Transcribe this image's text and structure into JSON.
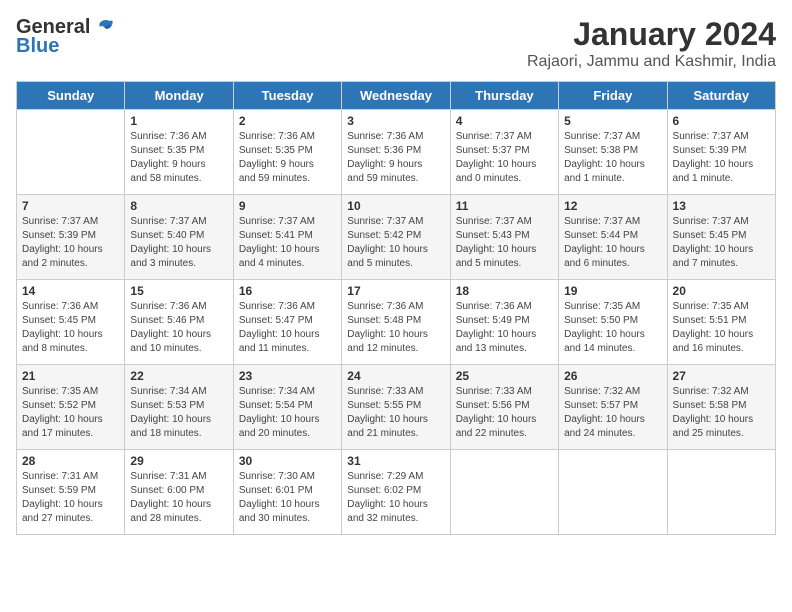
{
  "header": {
    "logo_general": "General",
    "logo_blue": "Blue",
    "month_title": "January 2024",
    "location": "Rajaori, Jammu and Kashmir, India"
  },
  "days_of_week": [
    "Sunday",
    "Monday",
    "Tuesday",
    "Wednesday",
    "Thursday",
    "Friday",
    "Saturday"
  ],
  "weeks": [
    [
      {
        "day": "",
        "info": ""
      },
      {
        "day": "1",
        "info": "Sunrise: 7:36 AM\nSunset: 5:35 PM\nDaylight: 9 hours\nand 58 minutes."
      },
      {
        "day": "2",
        "info": "Sunrise: 7:36 AM\nSunset: 5:35 PM\nDaylight: 9 hours\nand 59 minutes."
      },
      {
        "day": "3",
        "info": "Sunrise: 7:36 AM\nSunset: 5:36 PM\nDaylight: 9 hours\nand 59 minutes."
      },
      {
        "day": "4",
        "info": "Sunrise: 7:37 AM\nSunset: 5:37 PM\nDaylight: 10 hours\nand 0 minutes."
      },
      {
        "day": "5",
        "info": "Sunrise: 7:37 AM\nSunset: 5:38 PM\nDaylight: 10 hours\nand 1 minute."
      },
      {
        "day": "6",
        "info": "Sunrise: 7:37 AM\nSunset: 5:39 PM\nDaylight: 10 hours\nand 1 minute."
      }
    ],
    [
      {
        "day": "7",
        "info": "Sunrise: 7:37 AM\nSunset: 5:39 PM\nDaylight: 10 hours\nand 2 minutes."
      },
      {
        "day": "8",
        "info": "Sunrise: 7:37 AM\nSunset: 5:40 PM\nDaylight: 10 hours\nand 3 minutes."
      },
      {
        "day": "9",
        "info": "Sunrise: 7:37 AM\nSunset: 5:41 PM\nDaylight: 10 hours\nand 4 minutes."
      },
      {
        "day": "10",
        "info": "Sunrise: 7:37 AM\nSunset: 5:42 PM\nDaylight: 10 hours\nand 5 minutes."
      },
      {
        "day": "11",
        "info": "Sunrise: 7:37 AM\nSunset: 5:43 PM\nDaylight: 10 hours\nand 5 minutes."
      },
      {
        "day": "12",
        "info": "Sunrise: 7:37 AM\nSunset: 5:44 PM\nDaylight: 10 hours\nand 6 minutes."
      },
      {
        "day": "13",
        "info": "Sunrise: 7:37 AM\nSunset: 5:45 PM\nDaylight: 10 hours\nand 7 minutes."
      }
    ],
    [
      {
        "day": "14",
        "info": "Sunrise: 7:36 AM\nSunset: 5:45 PM\nDaylight: 10 hours\nand 8 minutes."
      },
      {
        "day": "15",
        "info": "Sunrise: 7:36 AM\nSunset: 5:46 PM\nDaylight: 10 hours\nand 10 minutes."
      },
      {
        "day": "16",
        "info": "Sunrise: 7:36 AM\nSunset: 5:47 PM\nDaylight: 10 hours\nand 11 minutes."
      },
      {
        "day": "17",
        "info": "Sunrise: 7:36 AM\nSunset: 5:48 PM\nDaylight: 10 hours\nand 12 minutes."
      },
      {
        "day": "18",
        "info": "Sunrise: 7:36 AM\nSunset: 5:49 PM\nDaylight: 10 hours\nand 13 minutes."
      },
      {
        "day": "19",
        "info": "Sunrise: 7:35 AM\nSunset: 5:50 PM\nDaylight: 10 hours\nand 14 minutes."
      },
      {
        "day": "20",
        "info": "Sunrise: 7:35 AM\nSunset: 5:51 PM\nDaylight: 10 hours\nand 16 minutes."
      }
    ],
    [
      {
        "day": "21",
        "info": "Sunrise: 7:35 AM\nSunset: 5:52 PM\nDaylight: 10 hours\nand 17 minutes."
      },
      {
        "day": "22",
        "info": "Sunrise: 7:34 AM\nSunset: 5:53 PM\nDaylight: 10 hours\nand 18 minutes."
      },
      {
        "day": "23",
        "info": "Sunrise: 7:34 AM\nSunset: 5:54 PM\nDaylight: 10 hours\nand 20 minutes."
      },
      {
        "day": "24",
        "info": "Sunrise: 7:33 AM\nSunset: 5:55 PM\nDaylight: 10 hours\nand 21 minutes."
      },
      {
        "day": "25",
        "info": "Sunrise: 7:33 AM\nSunset: 5:56 PM\nDaylight: 10 hours\nand 22 minutes."
      },
      {
        "day": "26",
        "info": "Sunrise: 7:32 AM\nSunset: 5:57 PM\nDaylight: 10 hours\nand 24 minutes."
      },
      {
        "day": "27",
        "info": "Sunrise: 7:32 AM\nSunset: 5:58 PM\nDaylight: 10 hours\nand 25 minutes."
      }
    ],
    [
      {
        "day": "28",
        "info": "Sunrise: 7:31 AM\nSunset: 5:59 PM\nDaylight: 10 hours\nand 27 minutes."
      },
      {
        "day": "29",
        "info": "Sunrise: 7:31 AM\nSunset: 6:00 PM\nDaylight: 10 hours\nand 28 minutes."
      },
      {
        "day": "30",
        "info": "Sunrise: 7:30 AM\nSunset: 6:01 PM\nDaylight: 10 hours\nand 30 minutes."
      },
      {
        "day": "31",
        "info": "Sunrise: 7:29 AM\nSunset: 6:02 PM\nDaylight: 10 hours\nand 32 minutes."
      },
      {
        "day": "",
        "info": ""
      },
      {
        "day": "",
        "info": ""
      },
      {
        "day": "",
        "info": ""
      }
    ]
  ]
}
